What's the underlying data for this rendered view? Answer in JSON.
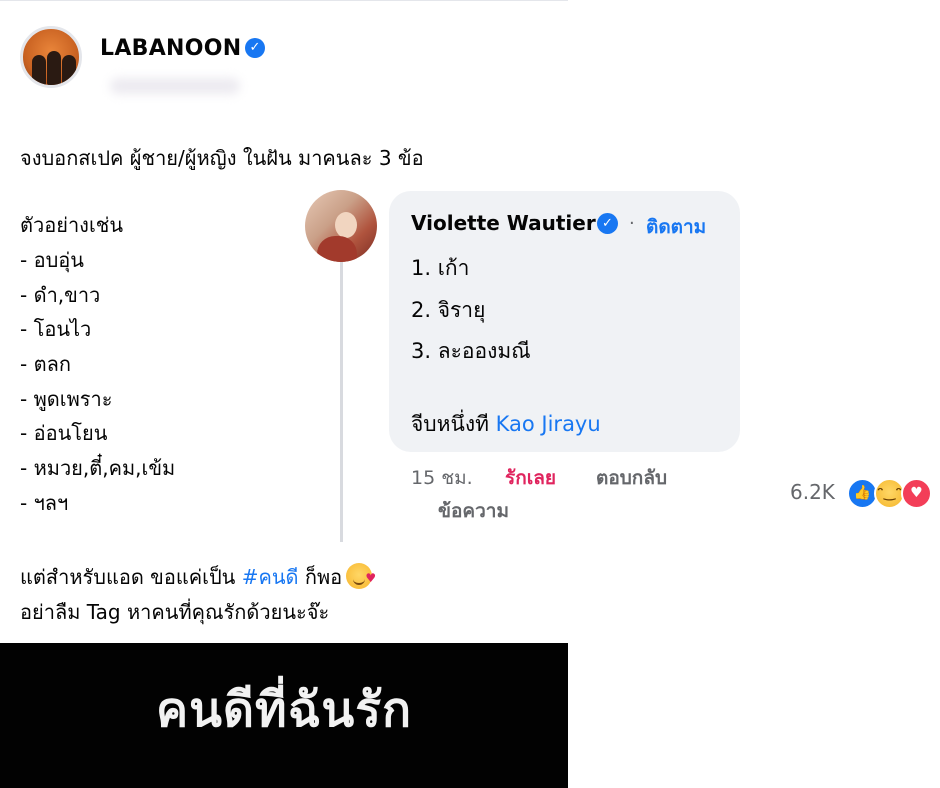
{
  "post": {
    "page_name": "LABANOON",
    "lines": [
      "จงบอกสเปค ผู้ชาย/ผู้หญิง ในฝัน มาคนละ 3 ข้อ",
      "ตัวอย่างเช่น",
      "- อบอุ่น",
      "- ดำ,ขาว",
      "- โอนไว",
      "- ตลก",
      "- พูดเพราะ",
      "- อ่อนโยน",
      "- หมวย,ตี๋,คม,เข้ม",
      "- ฯลฯ"
    ],
    "closing_prefix": "แต่สำหรับแอด ขอแค่เป็น ",
    "hashtag": "#คนดี",
    "closing_suffix": " ก็พอ",
    "closing_line2": "อย่าลืม Tag หาคนที่คุณรักด้วยนะจ๊ะ"
  },
  "comment": {
    "author": "Violette Wautier",
    "separator": "·",
    "follow_label": "ติดตาม",
    "lines": [
      "1. เก้า",
      "2. จิรายุ",
      "3. ละอองมณี"
    ],
    "last_prefix": "จีบหนึ่งที ",
    "mention": "Kao Jirayu",
    "time": "15 ชม.",
    "love_label": "รักเลย",
    "reply_label": "ตอบกลับ",
    "message_label": "ข้อความ",
    "reaction_count": "6.2K",
    "reactions": [
      "like-icon",
      "haha-icon",
      "love-icon"
    ]
  },
  "video": {
    "title": "คนดีที่ฉันรัก"
  },
  "colors": {
    "link": "#1877f2",
    "love": "#e0245e",
    "meta": "#65676b",
    "bubble": "#f0f2f5"
  }
}
